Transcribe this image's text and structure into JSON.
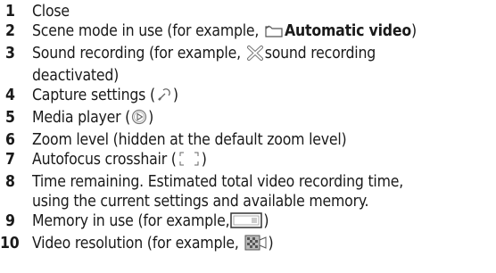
{
  "items": [
    {
      "num": "1",
      "text": "Close"
    },
    {
      "num": "2",
      "before": "Scene mode in use (for example, ",
      "icon": "scene-mode-automatic-icon",
      "bold": "Automatic video",
      "after": ")"
    },
    {
      "num": "3",
      "before": "Sound recording (for example, ",
      "icon": "sound-recording-off-icon",
      "after": "sound recording",
      "line2": "deactivated)"
    },
    {
      "num": "4",
      "before": "Capture settings (",
      "icon": "wrench-icon",
      "after": ")"
    },
    {
      "num": "5",
      "before": "Media player (",
      "icon": "play-icon",
      "after": ")"
    },
    {
      "num": "6",
      "text": "Zoom level (hidden at the default zoom level)"
    },
    {
      "num": "7",
      "before": "Autofocus crosshair (",
      "icon": "crosshair-icon",
      "after": ")"
    },
    {
      "num": "8",
      "text": "Time remaining. Estimated total video recording time,",
      "line2": "using the current settings and available memory."
    },
    {
      "num": "9",
      "before": "Memory in use (for example,",
      "icon": "memory-card-icon",
      "after": ")"
    },
    {
      "num": "10",
      "before": "Video resolution (for example, ",
      "icon": "video-resolution-icon",
      "after": ")"
    }
  ]
}
